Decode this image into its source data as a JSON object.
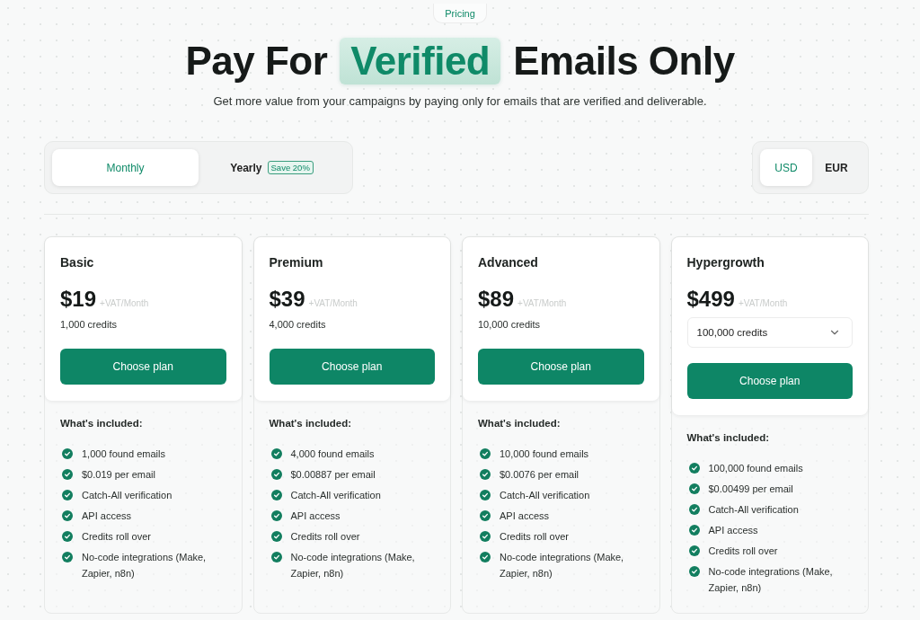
{
  "top_tag": {
    "label": "Pricing"
  },
  "heading": [
    {
      "text": "Pay For",
      "highlighted": false
    },
    {
      "text": "Verified",
      "highlighted": true
    },
    {
      "text": "Emails Only",
      "highlighted": false
    }
  ],
  "subtitle": "Get more value from your campaigns by paying only for emails that are verified and deliverable.",
  "billing_tabs": [
    {
      "label": "Monthly",
      "selected": true
    },
    {
      "label": "Yearly",
      "selected": false,
      "badge": "Save 20%"
    }
  ],
  "currency_tabs": [
    {
      "label": "USD",
      "selected": true
    },
    {
      "label": "EUR",
      "selected": false
    }
  ],
  "plans": [
    {
      "name": "Basic",
      "price": "$19",
      "price_note": "+VAT/Month",
      "credits": {
        "kind": "text",
        "value": "1,000 credits"
      },
      "button": "Choose plan",
      "included_title": "What's included:",
      "features": [
        "1,000 found emails",
        "$0.019 per email",
        "Catch-All verification",
        "API access",
        "Credits roll over",
        "No-code integrations (Make, Zapier, n8n)"
      ]
    },
    {
      "name": "Premium",
      "price": "$39",
      "price_note": "+VAT/Month",
      "credits": {
        "kind": "text",
        "value": "4,000 credits"
      },
      "button": "Choose plan",
      "included_title": "What's included:",
      "features": [
        "4,000 found emails",
        "$0.00887 per email",
        "Catch-All verification",
        "API access",
        "Credits roll over",
        "No-code integrations (Make, Zapier, n8n)"
      ]
    },
    {
      "name": "Advanced",
      "price": "$89",
      "price_note": "+VAT/Month",
      "credits": {
        "kind": "text",
        "value": "10,000 credits"
      },
      "button": "Choose plan",
      "included_title": "What's included:",
      "features": [
        "10,000 found emails",
        "$0.0076 per email",
        "Catch-All verification",
        "API access",
        "Credits roll over",
        "No-code integrations (Make, Zapier, n8n)"
      ]
    },
    {
      "name": "Hypergrowth",
      "price": "$499",
      "price_note": "+VAT/Month",
      "credits": {
        "kind": "select",
        "value": "100,000 credits"
      },
      "button": "Choose plan",
      "included_title": "What's included:",
      "features": [
        "100,000 found emails",
        "$0.00499 per email",
        "Catch-All verification",
        "API access",
        "Credits roll over",
        "No-code integrations (Make, Zapier, n8n)"
      ]
    }
  ]
}
